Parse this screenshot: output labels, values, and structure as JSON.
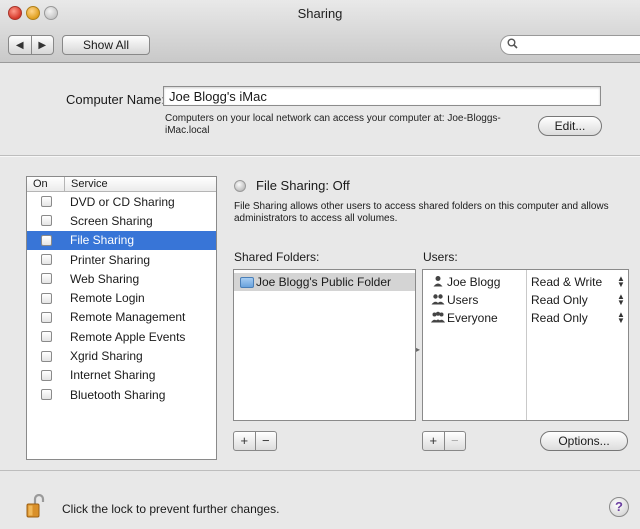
{
  "window": {
    "title": "Sharing"
  },
  "toolbar": {
    "back": "◀",
    "forward": "▶",
    "show_all": "Show All",
    "search_placeholder": ""
  },
  "computer_name": {
    "label": "Computer Name:",
    "value": "Joe Blogg's iMac",
    "description": "Computers on your local network can access your computer at: Joe-Bloggs-iMac.local",
    "edit_label": "Edit..."
  },
  "services": {
    "col_on": "On",
    "col_service": "Service",
    "items": [
      {
        "label": "DVD or CD Sharing",
        "on": false
      },
      {
        "label": "Screen Sharing",
        "on": false
      },
      {
        "label": "File Sharing",
        "on": false,
        "selected": true
      },
      {
        "label": "Printer Sharing",
        "on": false
      },
      {
        "label": "Web Sharing",
        "on": false
      },
      {
        "label": "Remote Login",
        "on": false
      },
      {
        "label": "Remote Management",
        "on": false
      },
      {
        "label": "Remote Apple Events",
        "on": false
      },
      {
        "label": "Xgrid Sharing",
        "on": false
      },
      {
        "label": "Internet Sharing",
        "on": false
      },
      {
        "label": "Bluetooth Sharing",
        "on": false
      }
    ]
  },
  "file_sharing": {
    "status": "File Sharing: Off",
    "description": "File Sharing allows other users to access shared folders on this computer and allows administrators to access all volumes.",
    "shared_folders_label": "Shared Folders:",
    "folders": [
      "Joe Blogg's Public Folder"
    ],
    "users_label": "Users:",
    "users": [
      {
        "name": "Joe Blogg",
        "permission": "Read & Write",
        "icon": "single-user-icon"
      },
      {
        "name": "Users",
        "permission": "Read Only",
        "icon": "group-icon"
      },
      {
        "name": "Everyone",
        "permission": "Read Only",
        "icon": "everyone-icon"
      }
    ],
    "add": "+",
    "remove": "−",
    "options_label": "Options..."
  },
  "footer": {
    "lock_text": "Click the lock to prevent further changes.",
    "help": "?"
  }
}
